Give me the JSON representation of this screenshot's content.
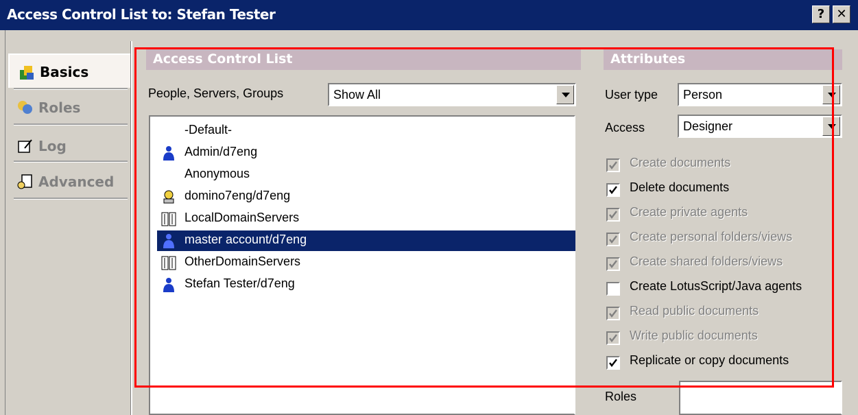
{
  "window": {
    "title": "Access Control List to: Stefan Tester",
    "help_btn": "?",
    "close_btn": "✕"
  },
  "nav": {
    "items": [
      {
        "label": "Basics",
        "icon": "basics-icon",
        "active": true
      },
      {
        "label": "Roles",
        "icon": "roles-icon",
        "active": false
      },
      {
        "label": "Log",
        "icon": "log-icon",
        "active": false
      },
      {
        "label": "Advanced",
        "icon": "advanced-icon",
        "active": false
      }
    ]
  },
  "acl": {
    "header": "Access Control List",
    "filter_label": "People, Servers, Groups",
    "filter_value": "Show All",
    "entries": [
      {
        "name": "-Default-",
        "icon": "none",
        "selected": false
      },
      {
        "name": "Admin/d7eng",
        "icon": "person-icon",
        "selected": false
      },
      {
        "name": "Anonymous",
        "icon": "none",
        "selected": false
      },
      {
        "name": "domino7eng/d7eng",
        "icon": "server-icon",
        "selected": false
      },
      {
        "name": "LocalDomainServers",
        "icon": "group-icon",
        "selected": false
      },
      {
        "name": "master account/d7eng",
        "icon": "person-icon",
        "selected": true
      },
      {
        "name": "OtherDomainServers",
        "icon": "group-icon",
        "selected": false
      },
      {
        "name": "Stefan Tester/d7eng",
        "icon": "person-icon",
        "selected": false
      }
    ]
  },
  "attributes": {
    "header": "Attributes",
    "user_type_label": "User type",
    "user_type_value": "Person",
    "access_label": "Access",
    "access_value": "Designer",
    "checkboxes": [
      {
        "label": "Create documents",
        "checked": true,
        "enabled": false
      },
      {
        "label": "Delete documents",
        "checked": true,
        "enabled": true
      },
      {
        "label": "Create private agents",
        "checked": true,
        "enabled": false
      },
      {
        "label": "Create personal folders/views",
        "checked": true,
        "enabled": false
      },
      {
        "label": "Create shared folders/views",
        "checked": true,
        "enabled": false
      },
      {
        "label": "Create LotusScript/Java agents",
        "checked": false,
        "enabled": true
      },
      {
        "label": "Read public documents",
        "checked": true,
        "enabled": false
      },
      {
        "label": "Write public documents",
        "checked": true,
        "enabled": false
      },
      {
        "label": "Replicate or copy documents",
        "checked": true,
        "enabled": true
      }
    ],
    "roles_label": "Roles"
  },
  "colors": {
    "titlebar": "#0a246a",
    "section_head": "#c8b6c0",
    "selection": "#0a246a",
    "highlight_frame": "#ff0000"
  }
}
